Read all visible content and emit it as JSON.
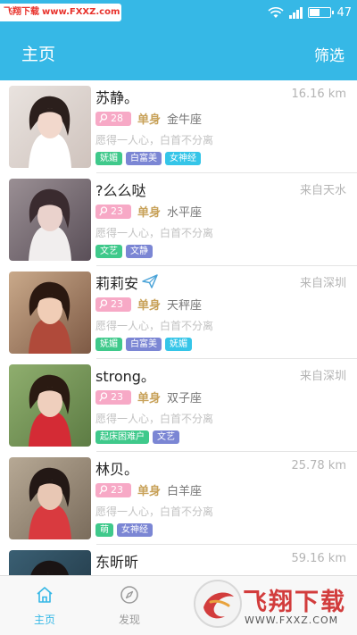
{
  "watermark_top": {
    "part_a": "飞翔下载",
    "part_b": "www.FXXZ.com"
  },
  "status_bar": {
    "battery_level": "47"
  },
  "header": {
    "title": "主页",
    "filter_label": "筛选"
  },
  "colors": {
    "primary": "#36b8e6",
    "age_badge": "#f7a9c6",
    "tag_green": "#3fc98b",
    "tag_purple": "#7b86d4",
    "tag_cyan": "#35c5e8",
    "marital": "#c8a25a"
  },
  "users": [
    {
      "name": "苏静。",
      "location": "16.16 km",
      "age": "28",
      "marital": "单身",
      "zodiac": "金牛座",
      "motto": "愿得一人心，白首不分离",
      "tags": [
        {
          "label": "妩媚",
          "color": "#3fc98b"
        },
        {
          "label": "白富美",
          "color": "#7b86d4"
        },
        {
          "label": "女神经",
          "color": "#35c5e8"
        }
      ]
    },
    {
      "name": "?么么哒",
      "location": "来自天水",
      "age": "23",
      "marital": "单身",
      "zodiac": "水平座",
      "motto": "愿得一人心，白首不分离",
      "tags": [
        {
          "label": "文艺",
          "color": "#3fc98b"
        },
        {
          "label": "文静",
          "color": "#7b86d4"
        }
      ]
    },
    {
      "name": "莉莉安",
      "location": "来自深圳",
      "age": "23",
      "marital": "单身",
      "zodiac": "天秤座",
      "motto": "愿得一人心，白首不分离",
      "tags": [
        {
          "label": "妩媚",
          "color": "#3fc98b"
        },
        {
          "label": "白富美",
          "color": "#7b86d4"
        },
        {
          "label": "妩媚",
          "color": "#35c5e8"
        }
      ]
    },
    {
      "name": "strong。",
      "location": "来自深圳",
      "age": "23",
      "marital": "单身",
      "zodiac": "双子座",
      "motto": "愿得一人心，白首不分离",
      "tags": [
        {
          "label": "起床困难户",
          "color": "#3fc98b"
        },
        {
          "label": "文艺",
          "color": "#7b86d4"
        }
      ]
    },
    {
      "name": "林贝。",
      "location": "25.78 km",
      "age": "23",
      "marital": "单身",
      "zodiac": "白羊座",
      "motto": "愿得一人心，白首不分离",
      "tags": [
        {
          "label": "萌",
          "color": "#3fc98b"
        },
        {
          "label": "女神经",
          "color": "#7b86d4"
        }
      ]
    },
    {
      "name": "东昕昕",
      "location": "59.16 km",
      "age": "",
      "marital": "",
      "zodiac": "",
      "motto": "",
      "tags": []
    }
  ],
  "tabs": [
    {
      "label": "主页",
      "icon": "home-icon",
      "active": true
    },
    {
      "label": "发现",
      "icon": "compass-icon",
      "active": false
    }
  ],
  "watermark_bottom": {
    "text": "飞翔下载",
    "url": "WWW.FXXZ.COM"
  }
}
